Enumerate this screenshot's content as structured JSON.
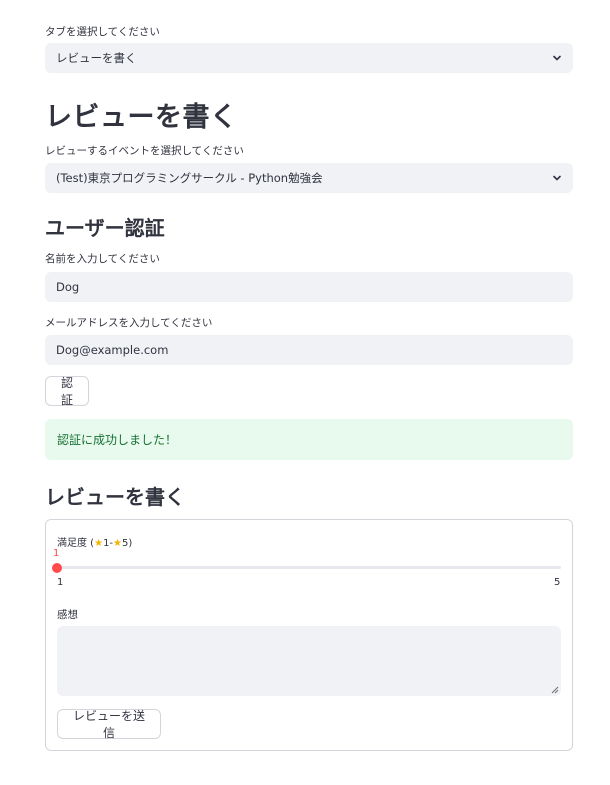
{
  "tab_select": {
    "label": "タブを選択してください",
    "value": "レビューを書く"
  },
  "page_title": "レビューを書く",
  "event_select": {
    "label": "レビューするイベントを選択してください",
    "value": "(Test)東京プログラミングサークル - Python勉強会"
  },
  "auth": {
    "heading": "ユーザー認証",
    "name_label": "名前を入力してください",
    "name_value": "Dog",
    "email_label": "メールアドレスを入力してください",
    "email_value": "Dog@example.com",
    "button_label": "認証",
    "success_message": "認証に成功しました！"
  },
  "review": {
    "heading": "レビューを書く",
    "rating_label_prefix": "満足度 (",
    "rating_label_min": "1-",
    "rating_label_max": "5)",
    "star_icon": "star-icon",
    "slider_value": "1",
    "slider_min": "1",
    "slider_max": "5",
    "comment_label": "感想",
    "comment_value": "",
    "submit_label": "レビューを送信"
  },
  "colors": {
    "accent": "#ff4b4b",
    "input_bg": "#f0f2f6",
    "success_bg": "#e8f9ee",
    "success_text": "#177233"
  }
}
